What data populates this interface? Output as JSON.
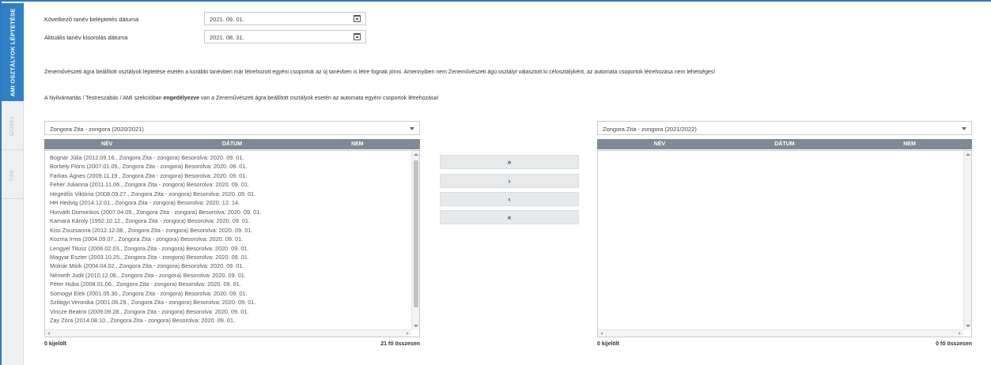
{
  "sidebar": {
    "tabs": [
      {
        "label": "AMI OSZTÁLYOK LÉPTETÉSE",
        "active": true
      },
      {
        "label": "SZŰRÉS",
        "active": false
      },
      {
        "label": "TIPP",
        "active": false
      }
    ]
  },
  "fields": {
    "next_year_label": "Következő tanév beléptetés dátuma",
    "next_year_value": "2021. 09. 01.",
    "current_year_label": "Aktuális tanév kisorolás dátuma",
    "current_year_value": "2021. 08. 31."
  },
  "info": {
    "line1": "Zeneművészeti ágra beállított osztályok léptetése esetén a korábbi tanévben már létrehozott egyéni csoportok az új tanévben is létre fognak jönni. Amennyiben nem Zeneművészeti ágú osztályt választott ki célosztályként, az automata csoportok létrehozása nem lehetséges!",
    "line2_pre": "A Nyilvántartás / Testreszabás / AMI szekcióban ",
    "line2_bold": "engedélyezve",
    "line2_post": " van a Zeneművészeti ágra beállított osztályok esetén az automata egyéni csoportok létrehozása!"
  },
  "left_panel": {
    "selected_class": "Zongora Zita - zongora (2020/2021)",
    "columns": [
      "NÉV",
      "DÁTUM",
      "NEM"
    ],
    "rows": [
      "Bognár Júlia (2012.09.16., Zongora Zita - zongora) Besorolva: 2020. 09. 01.",
      "Borbély Flóris (2007.01.05., Zongora Zita - zongora) Besorolva: 2020. 09. 01.",
      "Farkas Ágnes (2009.11.19., Zongora Zita - zongora) Besorolva: 2020. 09. 01.",
      "Fehér Julianna (2011.11.06., Zongora Zita - zongora) Besorolva: 2020. 09. 01.",
      "Hegedűs Viktória (2008.09.27., Zongora Zita - zongora) Besorolva: 2020. 09. 01.",
      "HH Hedvig (2014.12.01., Zongora Zita - zongora) Besorolva: 2020. 12. 14.",
      "Horváth Domonkos (2007.04.05., Zongora Zita - zongora) Besorolva: 2020. 09. 01.",
      "Kamara Károly (1992.10.12., Zongora Zita - zongora) Besorolva: 2020. 09. 01.",
      "Kiss Zsuzsanna (2012.12.08., Zongora Zita - zongora) Besorolva: 2020. 09. 01.",
      "Kozma Irma (2004.09.07., Zongora Zita - zongora) Besorolva: 2020. 09. 01.",
      "Lengyel Titusz (2006.02.03., Zongora Zita - zongora) Besorolva: 2020. 09. 01.",
      "Magyar Eszter (2003.10.25., Zongora Zita - zongora) Besorolva: 2020. 09. 01.",
      "Molnár Márk (2004.04.02., Zongora Zita - zongora) Besorolva: 2020. 09. 01.",
      "Németh Judit (2010.12.06., Zongora Zita - zongora) Besorolva: 2020. 09. 01.",
      "Péter Huba (2008.01.06., Zongora Zita - zongora) Besorolva: 2020. 09. 01.",
      "Somogyi Elek (2001.05.30., Zongora Zita - zongora) Besorolva: 2020. 09. 01.",
      "Szilágyi Veronika (2001.06.29., Zongora Zita - zongora) Besorolva: 2020. 09. 01.",
      "Vincze Beatrix (2009.09.28., Zongora Zita - zongora) Besorolva: 2020. 09. 01.",
      "Zay Zóra (2014.08.10., Zongora Zita - zongora) Besorolva: 2020. 09. 01."
    ],
    "selected_count": "0 kijelölt",
    "total": "21 fő összesen"
  },
  "right_panel": {
    "selected_class": "Zongora Zita - zongora (2021/2022)",
    "columns": [
      "NÉV",
      "DÁTUM",
      "NEM"
    ],
    "selected_count": "0 kijelölt",
    "total": "0 fő összesen"
  },
  "buttons": {
    "move_all_right": "»",
    "move_right": "›",
    "move_left": "‹",
    "move_all_left": "«"
  },
  "colors": {
    "accent": "#2f80c4",
    "grid_header": "#7e8a96",
    "button_bg": "#e7e9eb"
  }
}
